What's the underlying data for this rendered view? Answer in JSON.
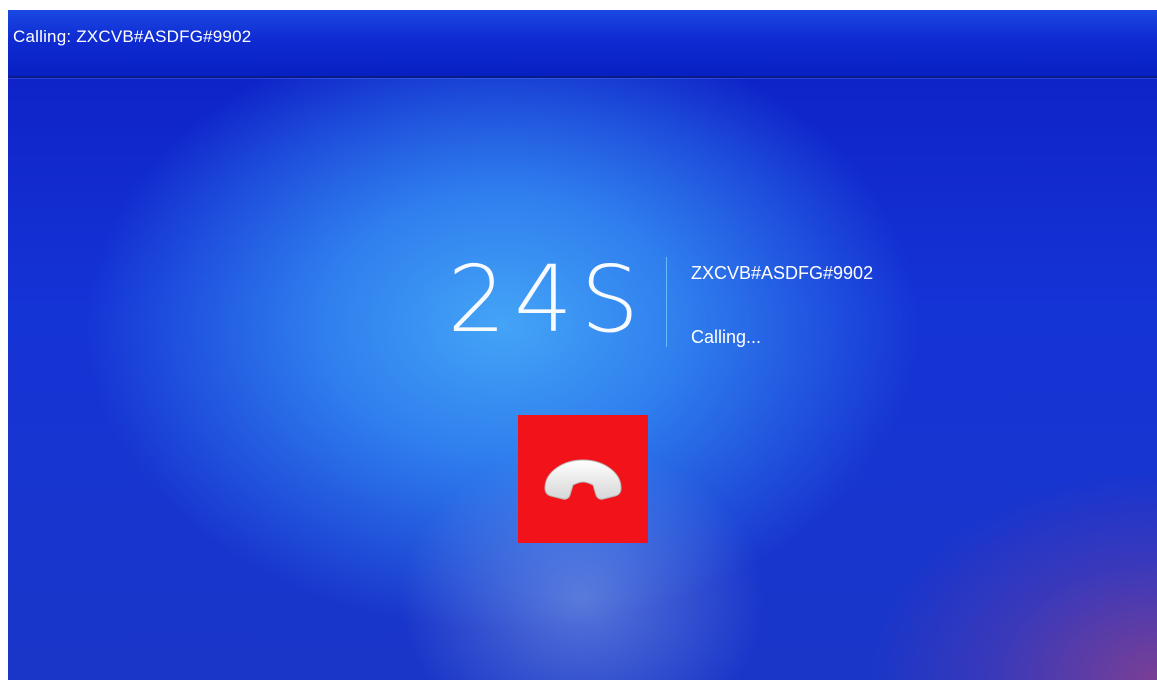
{
  "window": {
    "title": "Calling: ZXCVB#ASDFG#9902"
  },
  "call": {
    "elapsed": "24S",
    "callee": "ZXCVB#ASDFG#9902",
    "status": "Calling..."
  },
  "controls": {
    "hangup_icon": "phone-hangup-icon",
    "hangup_color": "#f2121a"
  },
  "colors": {
    "titlebar": "#0f2bd1",
    "background_center": "#44a4f6",
    "background_edge": "#1534d6",
    "divider": "#78d2ff"
  }
}
